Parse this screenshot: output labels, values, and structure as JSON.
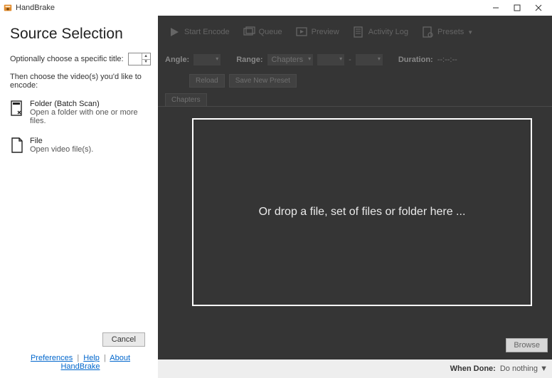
{
  "window": {
    "title": "HandBrake"
  },
  "leftpanel": {
    "heading": "Source Selection",
    "specific_title_label": "Optionally choose a specific title:",
    "choose_label": "Then choose the video(s) you'd like to encode:",
    "folder": {
      "title": "Folder (Batch Scan)",
      "desc": "Open a folder with one or more files."
    },
    "file": {
      "title": "File",
      "desc": "Open video file(s)."
    },
    "cancel_label": "Cancel",
    "links": {
      "preferences": "Preferences",
      "help": "Help",
      "about": "About HandBrake"
    }
  },
  "toolbar": {
    "start_encode": "Start Encode",
    "queue": "Queue",
    "preview": "Preview",
    "activity_log": "Activity Log",
    "presets": "Presets"
  },
  "fields": {
    "angle_label": "Angle:",
    "range_label": "Range:",
    "range_value": "Chapters",
    "dash": "-",
    "duration_label": "Duration:",
    "duration_value": "--:--:--"
  },
  "btnrow": {
    "reload": "Reload",
    "save_preset": "Save New Preset"
  },
  "tabs": {
    "chapters": "Chapters"
  },
  "dropzone": {
    "message": "Or drop a file, set of files or folder here ..."
  },
  "bottom": {
    "browse": "Browse",
    "when_done_label": "When Done:",
    "when_done_value": "Do nothing"
  }
}
